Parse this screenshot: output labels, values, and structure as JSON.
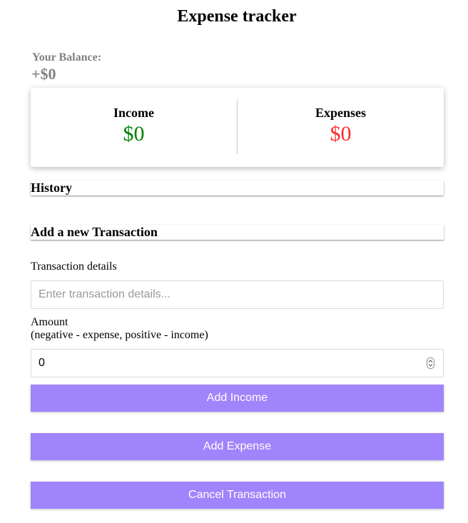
{
  "header": {
    "title": "Expense tracker"
  },
  "balance": {
    "label": "Your Balance:",
    "value": "+$0"
  },
  "summary": {
    "income_label": "Income",
    "income_value": "$0",
    "expenses_label": "Expenses",
    "expenses_value": "$0",
    "colors": {
      "income": "#008000",
      "expenses": "#ff2a2a"
    }
  },
  "history": {
    "heading": "History"
  },
  "new_transaction": {
    "heading": "Add a new Transaction",
    "details_label": "Transaction details",
    "details_placeholder": "Enter transaction details...",
    "details_value": "",
    "amount_label": "Amount",
    "amount_hint": "(negative - expense, positive - income)",
    "amount_value": "0"
  },
  "buttons": {
    "add_income": "Add Income",
    "add_expense": "Add Expense",
    "cancel": "Cancel Transaction",
    "color": "#a084fb"
  }
}
